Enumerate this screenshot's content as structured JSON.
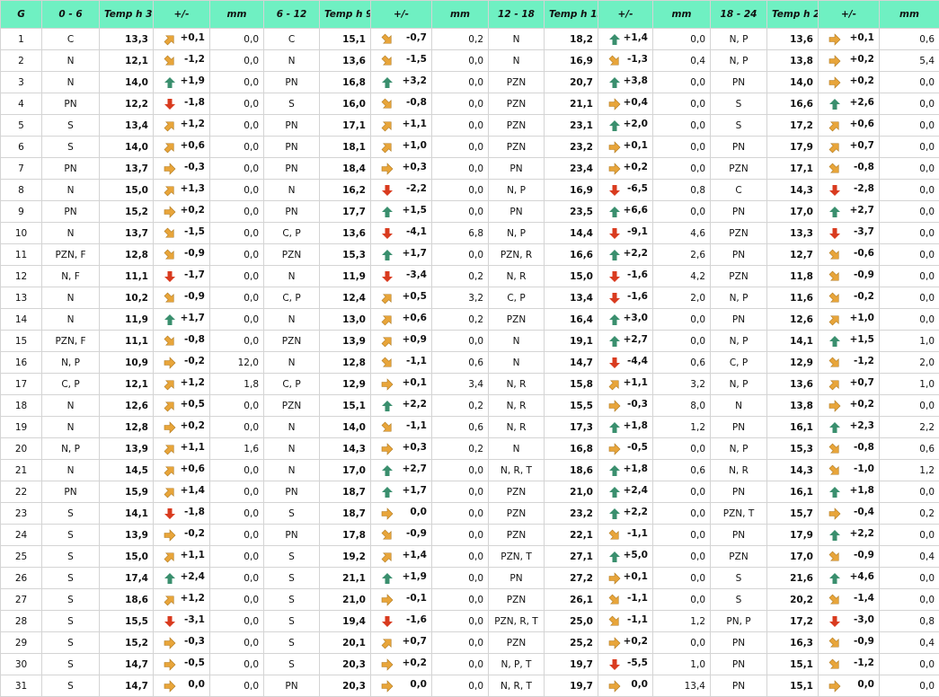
{
  "colors": {
    "header_bg": "#6ff0c2",
    "arrow_up": "#3a8f6e",
    "arrow_down": "#d93b1f",
    "arrow_flat": "#e8a53a",
    "arrow_diag": "#e8a53a"
  },
  "icons": {
    "up": "arrow-up-icon",
    "down": "arrow-down-icon",
    "right": "arrow-right-icon",
    "up_right": "arrow-up-right-icon",
    "down_right": "arrow-down-right-icon"
  },
  "headers": [
    "G",
    "0 - 6",
    "Temp h 3",
    "+/-",
    "mm",
    "6 - 12",
    "Temp h 9",
    "+/-",
    "mm",
    "12 - 18",
    "Temp h 15",
    "+/-",
    "mm",
    "18 - 24",
    "Temp h 21",
    "+/-",
    "mm"
  ],
  "rows": [
    [
      "1",
      "C",
      "13,3",
      "ur",
      "+0,1",
      "0,0",
      "C",
      "15,1",
      "dr",
      "-0,7",
      "0,2",
      "N",
      "18,2",
      "u",
      "+1,4",
      "0,0",
      "N, P",
      "13,6",
      "r",
      "+0,1",
      "0,6"
    ],
    [
      "2",
      "N",
      "12,1",
      "dr",
      "-1,2",
      "0,0",
      "N",
      "13,6",
      "dr",
      "-1,5",
      "0,0",
      "N",
      "16,9",
      "dr",
      "-1,3",
      "0,4",
      "N, P",
      "13,8",
      "r",
      "+0,2",
      "5,4"
    ],
    [
      "3",
      "N",
      "14,0",
      "u",
      "+1,9",
      "0,0",
      "PN",
      "16,8",
      "u",
      "+3,2",
      "0,0",
      "PZN",
      "20,7",
      "u",
      "+3,8",
      "0,0",
      "PN",
      "14,0",
      "r",
      "+0,2",
      "0,0"
    ],
    [
      "4",
      "PN",
      "12,2",
      "d",
      "-1,8",
      "0,0",
      "S",
      "16,0",
      "dr",
      "-0,8",
      "0,0",
      "PZN",
      "21,1",
      "r",
      "+0,4",
      "0,0",
      "S",
      "16,6",
      "u",
      "+2,6",
      "0,0"
    ],
    [
      "5",
      "S",
      "13,4",
      "ur",
      "+1,2",
      "0,0",
      "PN",
      "17,1",
      "ur",
      "+1,1",
      "0,0",
      "PZN",
      "23,1",
      "u",
      "+2,0",
      "0,0",
      "S",
      "17,2",
      "ur",
      "+0,6",
      "0,0"
    ],
    [
      "6",
      "S",
      "14,0",
      "ur",
      "+0,6",
      "0,0",
      "PN",
      "18,1",
      "ur",
      "+1,0",
      "0,0",
      "PZN",
      "23,2",
      "r",
      "+0,1",
      "0,0",
      "PN",
      "17,9",
      "ur",
      "+0,7",
      "0,0"
    ],
    [
      "7",
      "PN",
      "13,7",
      "r",
      "-0,3",
      "0,0",
      "PN",
      "18,4",
      "r",
      "+0,3",
      "0,0",
      "PN",
      "23,4",
      "r",
      "+0,2",
      "0,0",
      "PZN",
      "17,1",
      "dr",
      "-0,8",
      "0,0"
    ],
    [
      "8",
      "N",
      "15,0",
      "ur",
      "+1,3",
      "0,0",
      "N",
      "16,2",
      "d",
      "-2,2",
      "0,0",
      "N, P",
      "16,9",
      "d",
      "-6,5",
      "0,8",
      "C",
      "14,3",
      "d",
      "-2,8",
      "0,0"
    ],
    [
      "9",
      "PN",
      "15,2",
      "r",
      "+0,2",
      "0,0",
      "PN",
      "17,7",
      "u",
      "+1,5",
      "0,0",
      "PN",
      "23,5",
      "u",
      "+6,6",
      "0,0",
      "PN",
      "17,0",
      "u",
      "+2,7",
      "0,0"
    ],
    [
      "10",
      "N",
      "13,7",
      "dr",
      "-1,5",
      "0,0",
      "C, P",
      "13,6",
      "d",
      "-4,1",
      "6,8",
      "N, P",
      "14,4",
      "d",
      "-9,1",
      "4,6",
      "PZN",
      "13,3",
      "d",
      "-3,7",
      "0,0"
    ],
    [
      "11",
      "PZN, F",
      "12,8",
      "dr",
      "-0,9",
      "0,0",
      "PZN",
      "15,3",
      "u",
      "+1,7",
      "0,0",
      "PZN, R",
      "16,6",
      "u",
      "+2,2",
      "2,6",
      "PN",
      "12,7",
      "dr",
      "-0,6",
      "0,0"
    ],
    [
      "12",
      "N, F",
      "11,1",
      "d",
      "-1,7",
      "0,0",
      "N",
      "11,9",
      "d",
      "-3,4",
      "0,2",
      "N, R",
      "15,0",
      "d",
      "-1,6",
      "4,2",
      "PZN",
      "11,8",
      "dr",
      "-0,9",
      "0,0"
    ],
    [
      "13",
      "N",
      "10,2",
      "dr",
      "-0,9",
      "0,0",
      "C, P",
      "12,4",
      "ur",
      "+0,5",
      "3,2",
      "C, P",
      "13,4",
      "d",
      "-1,6",
      "2,0",
      "N, P",
      "11,6",
      "dr",
      "-0,2",
      "0,0"
    ],
    [
      "14",
      "N",
      "11,9",
      "u",
      "+1,7",
      "0,0",
      "N",
      "13,0",
      "ur",
      "+0,6",
      "0,2",
      "PZN",
      "16,4",
      "u",
      "+3,0",
      "0,0",
      "PN",
      "12,6",
      "ur",
      "+1,0",
      "0,0"
    ],
    [
      "15",
      "PZN, F",
      "11,1",
      "dr",
      "-0,8",
      "0,0",
      "PZN",
      "13,9",
      "ur",
      "+0,9",
      "0,0",
      "N",
      "19,1",
      "u",
      "+2,7",
      "0,0",
      "N, P",
      "14,1",
      "u",
      "+1,5",
      "1,0"
    ],
    [
      "16",
      "N, P",
      "10,9",
      "r",
      "-0,2",
      "12,0",
      "N",
      "12,8",
      "dr",
      "-1,1",
      "0,6",
      "N",
      "14,7",
      "d",
      "-4,4",
      "0,6",
      "C, P",
      "12,9",
      "dr",
      "-1,2",
      "2,0"
    ],
    [
      "17",
      "C, P",
      "12,1",
      "ur",
      "+1,2",
      "1,8",
      "C, P",
      "12,9",
      "r",
      "+0,1",
      "3,4",
      "N, R",
      "15,8",
      "ur",
      "+1,1",
      "3,2",
      "N, P",
      "13,6",
      "ur",
      "+0,7",
      "1,0"
    ],
    [
      "18",
      "N",
      "12,6",
      "ur",
      "+0,5",
      "0,0",
      "PZN",
      "15,1",
      "u",
      "+2,2",
      "0,2",
      "N, R",
      "15,5",
      "r",
      "-0,3",
      "8,0",
      "N",
      "13,8",
      "r",
      "+0,2",
      "0,0"
    ],
    [
      "19",
      "N",
      "12,8",
      "r",
      "+0,2",
      "0,0",
      "N",
      "14,0",
      "dr",
      "-1,1",
      "0,6",
      "N, R",
      "17,3",
      "u",
      "+1,8",
      "1,2",
      "PN",
      "16,1",
      "u",
      "+2,3",
      "2,2"
    ],
    [
      "20",
      "N, P",
      "13,9",
      "ur",
      "+1,1",
      "1,6",
      "N",
      "14,3",
      "r",
      "+0,3",
      "0,2",
      "N",
      "16,8",
      "r",
      "-0,5",
      "0,0",
      "N, P",
      "15,3",
      "dr",
      "-0,8",
      "0,6"
    ],
    [
      "21",
      "N",
      "14,5",
      "ur",
      "+0,6",
      "0,0",
      "N",
      "17,0",
      "u",
      "+2,7",
      "0,0",
      "N, R, T",
      "18,6",
      "u",
      "+1,8",
      "0,6",
      "N, R",
      "14,3",
      "dr",
      "-1,0",
      "1,2"
    ],
    [
      "22",
      "PN",
      "15,9",
      "ur",
      "+1,4",
      "0,0",
      "PN",
      "18,7",
      "u",
      "+1,7",
      "0,0",
      "PZN",
      "21,0",
      "u",
      "+2,4",
      "0,0",
      "PN",
      "16,1",
      "u",
      "+1,8",
      "0,0"
    ],
    [
      "23",
      "S",
      "14,1",
      "d",
      "-1,8",
      "0,0",
      "S",
      "18,7",
      "r",
      "0,0",
      "0,0",
      "PZN",
      "23,2",
      "u",
      "+2,2",
      "0,0",
      "PZN, T",
      "15,7",
      "r",
      "-0,4",
      "0,2"
    ],
    [
      "24",
      "S",
      "13,9",
      "r",
      "-0,2",
      "0,0",
      "PN",
      "17,8",
      "dr",
      "-0,9",
      "0,0",
      "PZN",
      "22,1",
      "dr",
      "-1,1",
      "0,0",
      "PN",
      "17,9",
      "u",
      "+2,2",
      "0,0"
    ],
    [
      "25",
      "S",
      "15,0",
      "ur",
      "+1,1",
      "0,0",
      "S",
      "19,2",
      "ur",
      "+1,4",
      "0,0",
      "PZN, T",
      "27,1",
      "u",
      "+5,0",
      "0,0",
      "PZN",
      "17,0",
      "dr",
      "-0,9",
      "0,4"
    ],
    [
      "26",
      "S",
      "17,4",
      "u",
      "+2,4",
      "0,0",
      "S",
      "21,1",
      "u",
      "+1,9",
      "0,0",
      "PN",
      "27,2",
      "r",
      "+0,1",
      "0,0",
      "S",
      "21,6",
      "u",
      "+4,6",
      "0,0"
    ],
    [
      "27",
      "S",
      "18,6",
      "ur",
      "+1,2",
      "0,0",
      "S",
      "21,0",
      "r",
      "-0,1",
      "0,0",
      "PZN",
      "26,1",
      "dr",
      "-1,1",
      "0,0",
      "S",
      "20,2",
      "dr",
      "-1,4",
      "0,0"
    ],
    [
      "28",
      "S",
      "15,5",
      "d",
      "-3,1",
      "0,0",
      "S",
      "19,4",
      "d",
      "-1,6",
      "0,0",
      "PZN, R, T",
      "25,0",
      "dr",
      "-1,1",
      "1,2",
      "PN, P",
      "17,2",
      "d",
      "-3,0",
      "0,8"
    ],
    [
      "29",
      "S",
      "15,2",
      "r",
      "-0,3",
      "0,0",
      "S",
      "20,1",
      "ur",
      "+0,7",
      "0,0",
      "PZN",
      "25,2",
      "r",
      "+0,2",
      "0,0",
      "PN",
      "16,3",
      "dr",
      "-0,9",
      "0,4"
    ],
    [
      "30",
      "S",
      "14,7",
      "r",
      "-0,5",
      "0,0",
      "S",
      "20,3",
      "r",
      "+0,2",
      "0,0",
      "N, P, T",
      "19,7",
      "d",
      "-5,5",
      "1,0",
      "PN",
      "15,1",
      "dr",
      "-1,2",
      "0,0"
    ],
    [
      "31",
      "S",
      "14,7",
      "r",
      "0,0",
      "0,0",
      "PN",
      "20,3",
      "r",
      "0,0",
      "0,0",
      "N, R, T",
      "19,7",
      "r",
      "0,0",
      "13,4",
      "PN",
      "15,1",
      "r",
      "0,0",
      "0,0"
    ]
  ]
}
